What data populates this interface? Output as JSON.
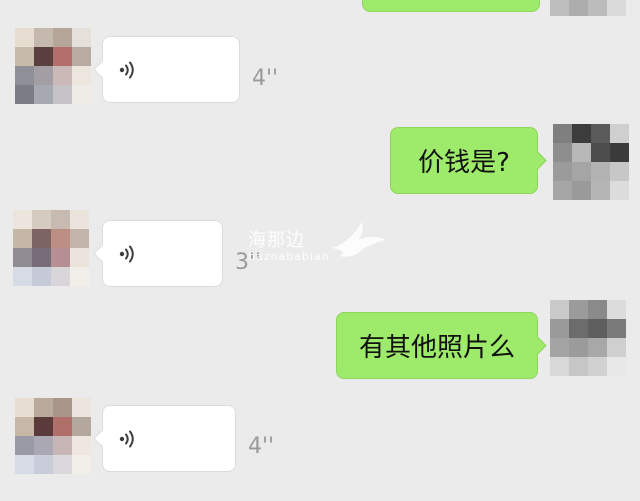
{
  "messages": [
    {
      "type": "outgoing-partial"
    },
    {
      "type": "voice",
      "duration": "4''"
    },
    {
      "type": "text",
      "text": "价钱是?"
    },
    {
      "type": "voice",
      "duration": "3''"
    },
    {
      "type": "text",
      "text": "有其他照片么"
    },
    {
      "type": "voice",
      "duration": "4''"
    }
  ],
  "watermark": {
    "title": "海那边",
    "subtitle": "haznababian"
  },
  "colors": {
    "background": "#ebebeb",
    "outgoing_bubble": "#9eea6a",
    "incoming_bubble": "#ffffff",
    "duration_text": "#9a9a9a"
  },
  "icons": {
    "voice": "voice-wave-icon",
    "avatar": "pixelated-avatar"
  }
}
